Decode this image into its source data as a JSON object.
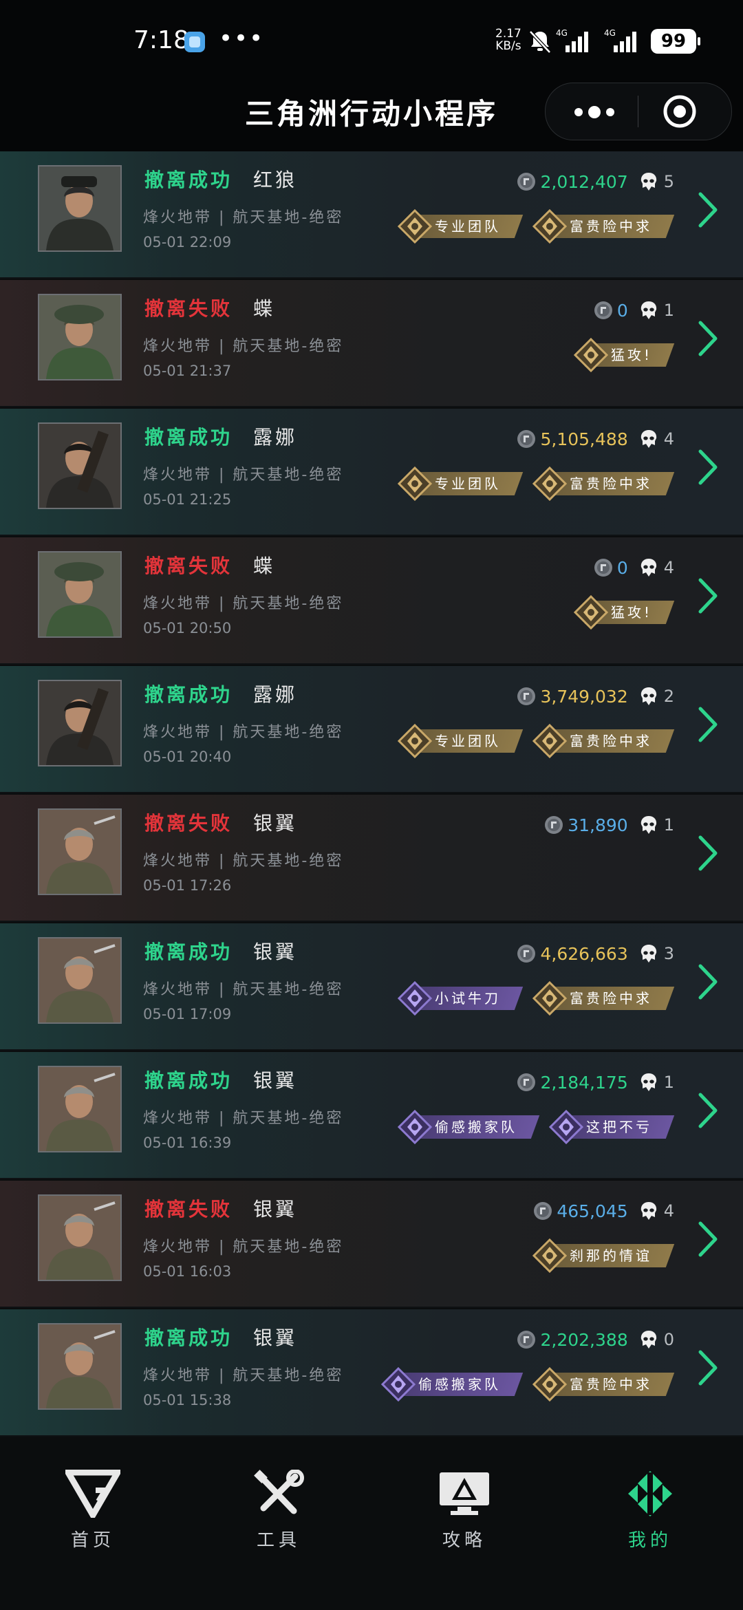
{
  "status_bar": {
    "time": "7:18",
    "dots": "•••",
    "net_speed": "2.17",
    "net_unit": "KB/s",
    "signal1": "4G",
    "signal2": "4G",
    "battery": "99"
  },
  "nav": {
    "title": "三角洲行动小程序"
  },
  "records": [
    {
      "result": "撤离成功",
      "status": "success",
      "operator": "红狼",
      "map": "烽火地带 | 航天基地-绝密",
      "time": "05-01 22:09",
      "value": "2,012,407",
      "value_color": "#2ed48c",
      "kills": "5",
      "avatar": "redwolf",
      "tags": [
        {
          "label": "专业团队",
          "style": "gold"
        },
        {
          "label": "富贵险中求",
          "style": "gold"
        }
      ]
    },
    {
      "result": "撤离失败",
      "status": "fail",
      "operator": "蝶",
      "map": "烽火地带 | 航天基地-绝密",
      "time": "05-01 21:37",
      "value": "0",
      "value_color": "#5aaee8",
      "kills": "1",
      "avatar": "butterfly",
      "tags": [
        {
          "label": "猛攻!",
          "style": "gold"
        }
      ]
    },
    {
      "result": "撤离成功",
      "status": "success",
      "operator": "露娜",
      "map": "烽火地带 | 航天基地-绝密",
      "time": "05-01 21:25",
      "value": "5,105,488",
      "value_color": "#e7c35a",
      "kills": "4",
      "avatar": "luna",
      "tags": [
        {
          "label": "专业团队",
          "style": "gold"
        },
        {
          "label": "富贵险中求",
          "style": "gold"
        }
      ]
    },
    {
      "result": "撤离失败",
      "status": "fail",
      "operator": "蝶",
      "map": "烽火地带 | 航天基地-绝密",
      "time": "05-01 20:50",
      "value": "0",
      "value_color": "#5aaee8",
      "kills": "4",
      "avatar": "butterfly",
      "tags": [
        {
          "label": "猛攻!",
          "style": "gold"
        }
      ]
    },
    {
      "result": "撤离成功",
      "status": "success",
      "operator": "露娜",
      "map": "烽火地带 | 航天基地-绝密",
      "time": "05-01 20:40",
      "value": "3,749,032",
      "value_color": "#e7c35a",
      "kills": "2",
      "avatar": "luna",
      "tags": [
        {
          "label": "专业团队",
          "style": "gold"
        },
        {
          "label": "富贵险中求",
          "style": "gold"
        }
      ]
    },
    {
      "result": "撤离失败",
      "status": "fail",
      "operator": "银翼",
      "map": "烽火地带 | 航天基地-绝密",
      "time": "05-01 17:26",
      "value": "31,890",
      "value_color": "#5aaee8",
      "kills": "1",
      "avatar": "silverwing",
      "tags": []
    },
    {
      "result": "撤离成功",
      "status": "success",
      "operator": "银翼",
      "map": "烽火地带 | 航天基地-绝密",
      "time": "05-01 17:09",
      "value": "4,626,663",
      "value_color": "#e7c35a",
      "kills": "3",
      "avatar": "silverwing",
      "tags": [
        {
          "label": "小试牛刀",
          "style": "purple"
        },
        {
          "label": "富贵险中求",
          "style": "gold"
        }
      ]
    },
    {
      "result": "撤离成功",
      "status": "success",
      "operator": "银翼",
      "map": "烽火地带 | 航天基地-绝密",
      "time": "05-01 16:39",
      "value": "2,184,175",
      "value_color": "#2ed48c",
      "kills": "1",
      "avatar": "silverwing",
      "tags": [
        {
          "label": "偷感搬家队",
          "style": "purple"
        },
        {
          "label": "这把不亏",
          "style": "purple"
        }
      ]
    },
    {
      "result": "撤离失败",
      "status": "fail",
      "operator": "银翼",
      "map": "烽火地带 | 航天基地-绝密",
      "time": "05-01 16:03",
      "value": "465,045",
      "value_color": "#5aaee8",
      "kills": "4",
      "avatar": "silverwing",
      "tags": [
        {
          "label": "刹那的情谊",
          "style": "gold"
        }
      ]
    },
    {
      "result": "撤离成功",
      "status": "success",
      "operator": "银翼",
      "map": "烽火地带 | 航天基地-绝密",
      "time": "05-01 15:38",
      "value": "2,202,388",
      "value_color": "#2ed48c",
      "kills": "0",
      "avatar": "silverwing",
      "tags": [
        {
          "label": "偷感搬家队",
          "style": "purple"
        },
        {
          "label": "富贵险中求",
          "style": "gold"
        }
      ]
    }
  ],
  "tabbar": {
    "items": [
      {
        "label": "首页",
        "icon": "home-logo-icon"
      },
      {
        "label": "工具",
        "icon": "tools-icon"
      },
      {
        "label": "攻略",
        "icon": "guide-monitor-icon"
      },
      {
        "label": "我的",
        "icon": "profile-logo-icon"
      }
    ],
    "active_index": 3,
    "active_color": "#2ed48c"
  }
}
